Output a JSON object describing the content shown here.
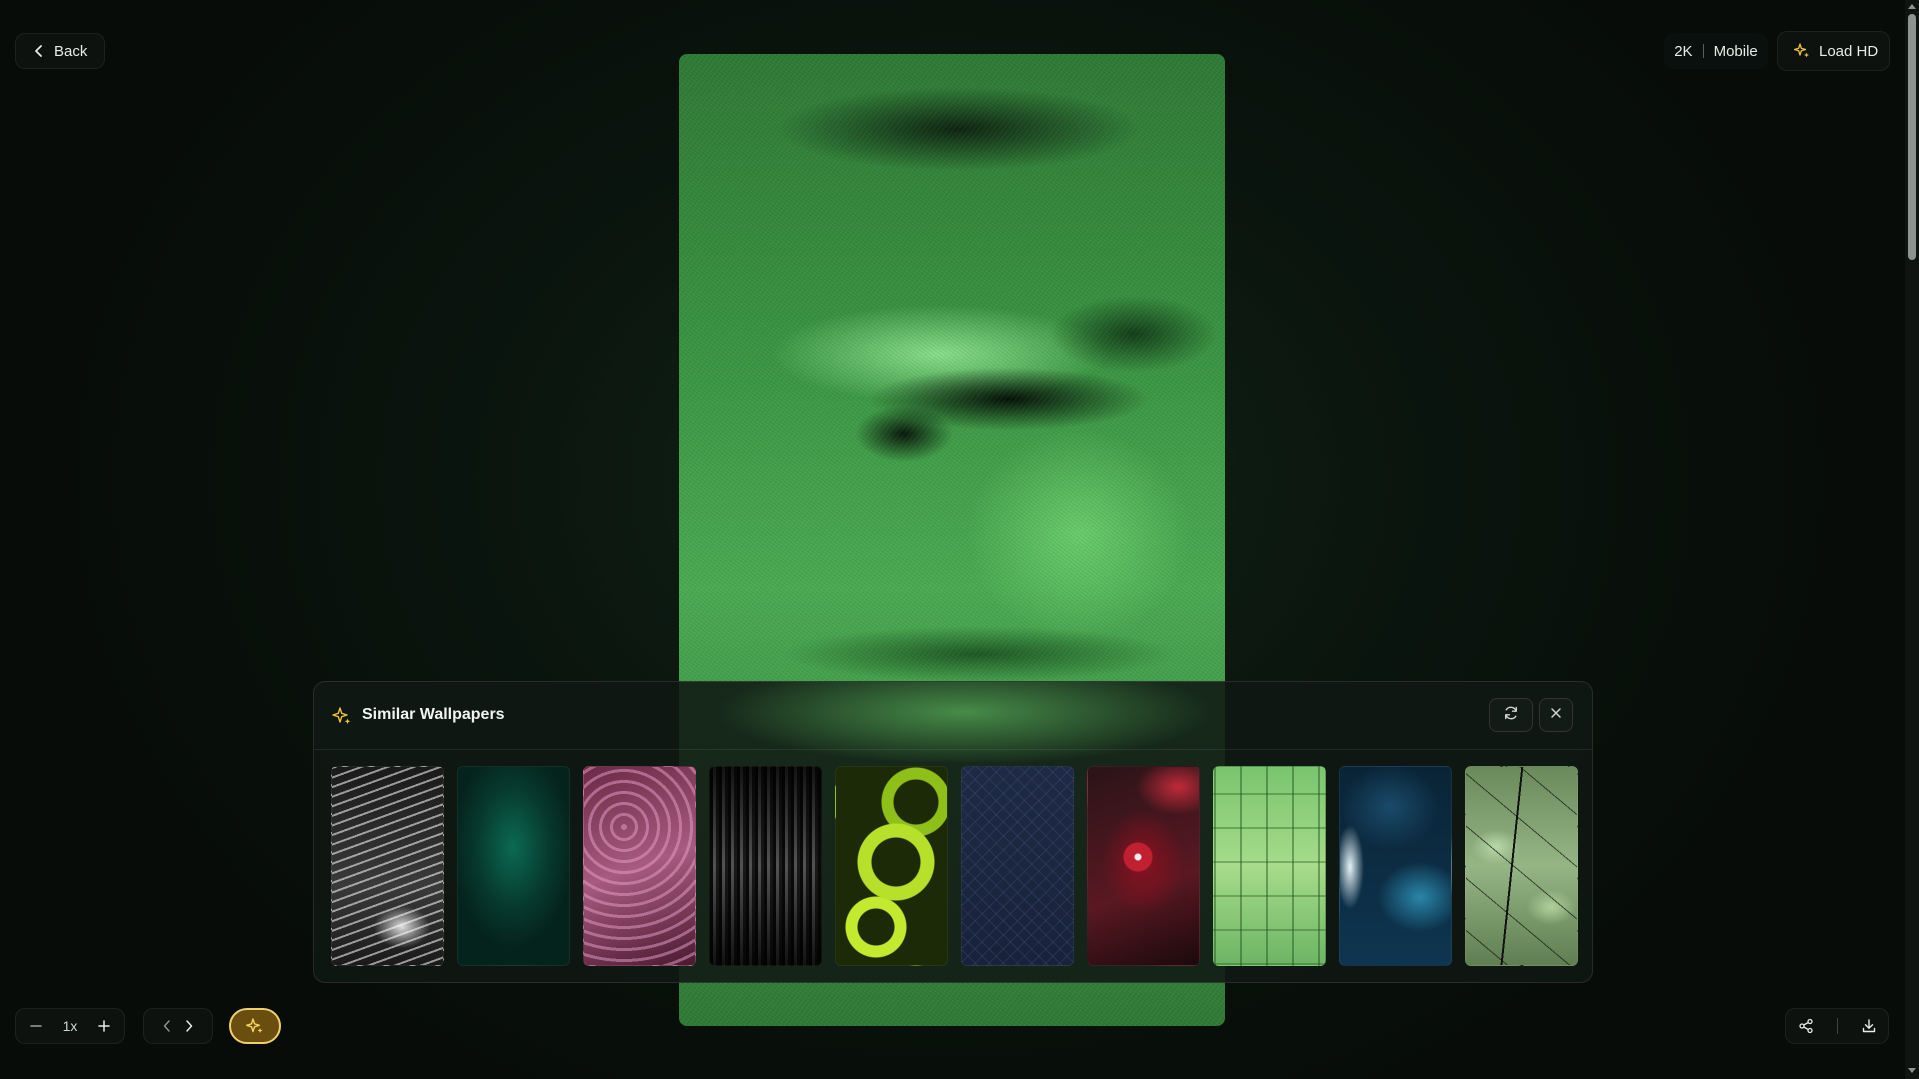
{
  "header": {
    "back_label": "Back",
    "resolution": "2K",
    "device": "Mobile",
    "load_hd_label": "Load HD"
  },
  "similar": {
    "title": "Similar Wallpapers",
    "thumbnails": [
      "black-white-sketch",
      "teal-gradient",
      "pink-texture",
      "grayscale-waves",
      "lime-swirl",
      "navy-pattern",
      "red-fractal",
      "green-blocks",
      "blue-abstract",
      "sage-branches"
    ]
  },
  "controls": {
    "zoom_level": "1x"
  },
  "colors": {
    "accent": "#f0c23a",
    "background": "#0b160f"
  }
}
